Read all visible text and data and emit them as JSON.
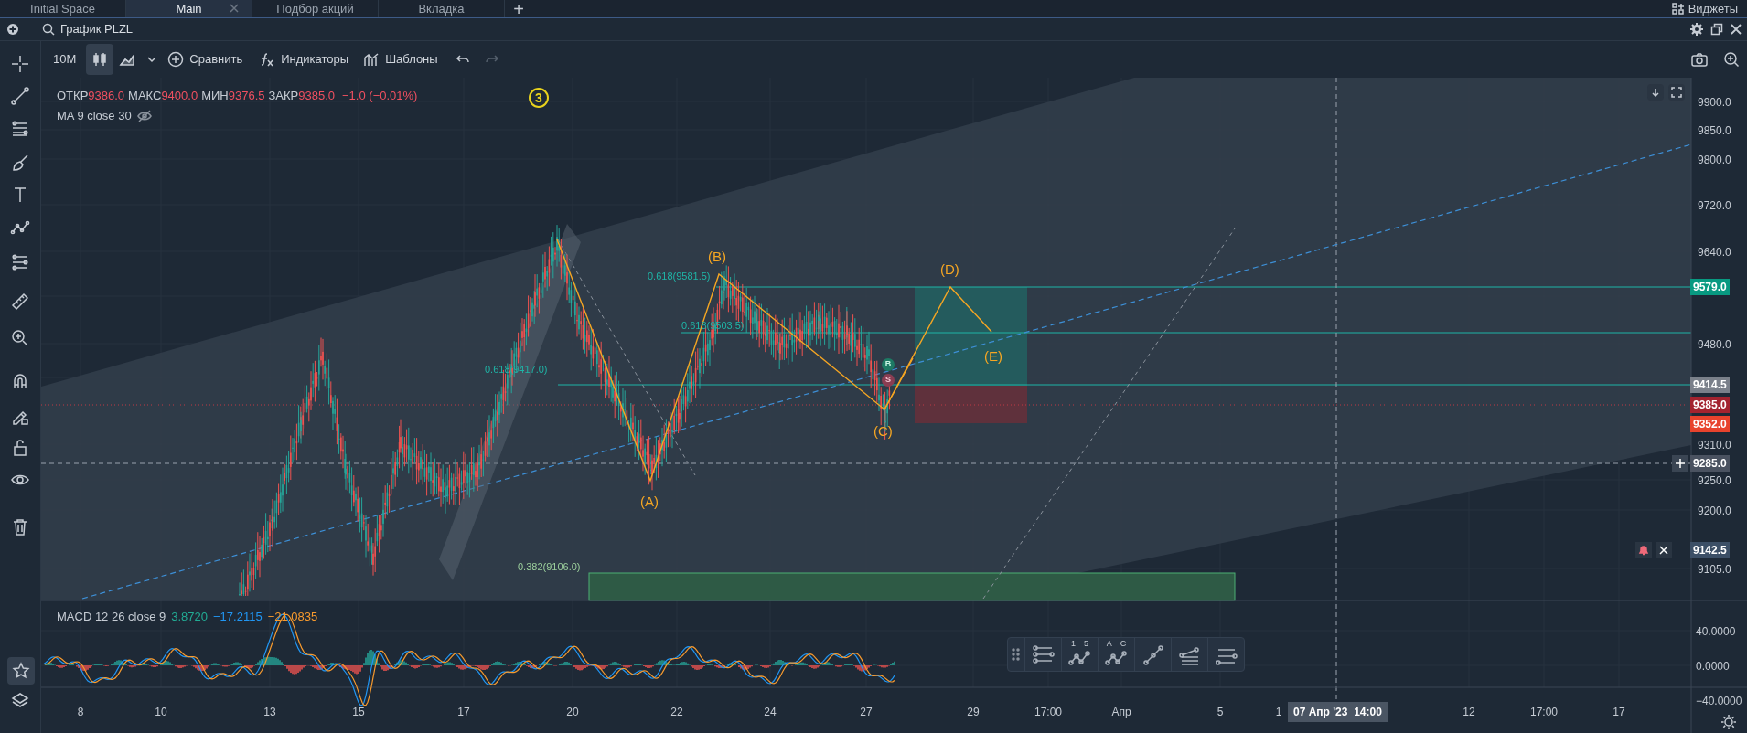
{
  "tabs": [
    {
      "label": "Initial Space",
      "selected": false,
      "closable": false
    },
    {
      "label": "Main",
      "selected": true,
      "closable": true
    },
    {
      "label": "Подбор акций",
      "selected": false,
      "closable": false
    },
    {
      "label": "Вкладка",
      "selected": false,
      "closable": false
    }
  ],
  "new_tab_button": "+",
  "widgets_button": "Виджеты",
  "chart_title": "График PLZL",
  "toolbar": {
    "interval": "10M",
    "compare": "Сравнить",
    "indicators": "Индикаторы",
    "templates": "Шаблоны"
  },
  "chart_types": [
    {
      "kind": "candles",
      "selected": true
    },
    {
      "kind": "area",
      "selected": false
    }
  ],
  "favorites_button": {
    "selected": true
  },
  "legend": {
    "ohlc": [
      {
        "label": "ОТКР",
        "value": "9386.0"
      },
      {
        "label": "МАКС",
        "value": "9400.0"
      },
      {
        "label": "МИН",
        "value": "9376.5"
      },
      {
        "label": "ЗАКР",
        "value": "9385.0"
      }
    ],
    "change": "−1.0 (−0.01%)",
    "ma": "MA 9 close 30"
  },
  "marker_badge": "3",
  "wave_labels": [
    "(A)",
    "(B)",
    "(C)",
    "(D)",
    "(E)"
  ],
  "fib_labels": [
    "0.618(9581.5)",
    "0.618(9503.5)",
    "0.618(9417.0)",
    "0.382(9106.0)"
  ],
  "trade_markers": [
    "B",
    "S"
  ],
  "price_axis": {
    "labels": [
      "9900.0",
      "9850.0",
      "9800.0",
      "9720.0",
      "9640.0",
      "9480.0",
      "9310.0",
      "9250.0",
      "9200.0",
      "9105.0"
    ],
    "badges": [
      {
        "text": "9579.0",
        "color": "#089981"
      },
      {
        "text": "9414.5",
        "color": "#7a808a"
      },
      {
        "text": "9385.0",
        "color": "#a3232f"
      },
      {
        "text": "9352.0",
        "color": "#e8432d"
      },
      {
        "text": "9285.0",
        "color": "#4a5260"
      },
      {
        "text": "9142.5",
        "color": "#3c4f66"
      }
    ]
  },
  "macd": {
    "title": "MACD 12 26 close 9",
    "values": [
      {
        "text": "3.8720",
        "color": "#22ab94"
      },
      {
        "text": "−17.2115",
        "color": "#2196f3"
      },
      {
        "text": "−21.0835",
        "color": "#f79a2e"
      }
    ],
    "axis": [
      "40.0000",
      "0.0000",
      "−40.0000"
    ]
  },
  "time_axis": {
    "labels": [
      "8",
      "10",
      "13",
      "15",
      "17",
      "20",
      "22",
      "24",
      "27",
      "29",
      "17:00",
      "Апр",
      "5",
      "1",
      "12",
      "17:00",
      "17"
    ],
    "crosshair": "07 Апр '23  14:00"
  },
  "drawing_toolbar": [
    {
      "kind": "fib"
    },
    {
      "kind": "wave",
      "marks": [
        "1",
        "5"
      ]
    },
    {
      "kind": "wave",
      "marks": [
        "A",
        "C"
      ]
    },
    {
      "kind": "line"
    },
    {
      "kind": "pitchfork"
    },
    {
      "kind": "levels"
    }
  ]
}
